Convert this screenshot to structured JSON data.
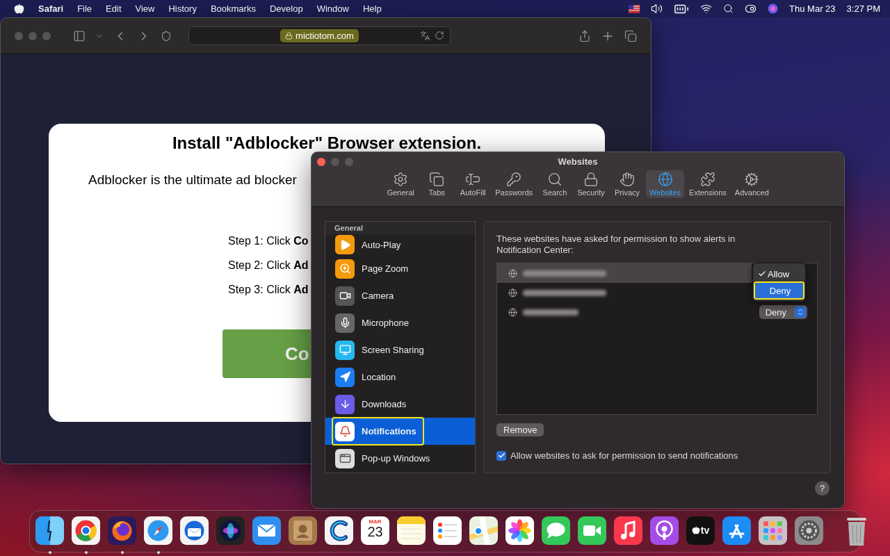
{
  "menu_bar": {
    "app": "Safari",
    "menus": [
      "File",
      "Edit",
      "View",
      "History",
      "Bookmarks",
      "Develop",
      "Window",
      "Help"
    ],
    "date": "Thu Mar 23",
    "time": "3:27 PM"
  },
  "browser": {
    "address": "mictiotom.com",
    "page": {
      "title": "Install \"Adblocker\" Browser extension.",
      "intro": "Adblocker is the ultimate ad blocker",
      "steps": [
        "Step 1: Click **Co**",
        "Step 2: Click **Ad**",
        "Step 3: Click **Ad**"
      ],
      "button": "Co"
    }
  },
  "preferences": {
    "title": "Websites",
    "tabs": [
      {
        "label": "General",
        "kind": "general",
        "selected": false
      },
      {
        "label": "Tabs",
        "kind": "tabs",
        "selected": false
      },
      {
        "label": "AutoFill",
        "kind": "autofill",
        "selected": false
      },
      {
        "label": "Passwords",
        "kind": "passwords",
        "selected": false
      },
      {
        "label": "Search",
        "kind": "search",
        "selected": false
      },
      {
        "label": "Security",
        "kind": "security",
        "selected": false
      },
      {
        "label": "Privacy",
        "kind": "privacy",
        "selected": false
      },
      {
        "label": "Websites",
        "kind": "websites",
        "selected": true
      },
      {
        "label": "Extensions",
        "kind": "extensions",
        "selected": false
      },
      {
        "label": "Advanced",
        "kind": "advanced",
        "selected": false
      }
    ],
    "sidebar": {
      "header": "General",
      "items": [
        {
          "label": "Auto-Play",
          "kind": "autoplay",
          "selected": false,
          "highlighted": false
        },
        {
          "label": "Page Zoom",
          "kind": "zoom",
          "selected": false,
          "highlighted": false
        },
        {
          "label": "Camera",
          "kind": "camera",
          "selected": false,
          "highlighted": false
        },
        {
          "label": "Microphone",
          "kind": "microphone",
          "selected": false,
          "highlighted": false
        },
        {
          "label": "Screen Sharing",
          "kind": "screen",
          "selected": false,
          "highlighted": false
        },
        {
          "label": "Location",
          "kind": "location",
          "selected": false,
          "highlighted": false
        },
        {
          "label": "Downloads",
          "kind": "downloads",
          "selected": false,
          "highlighted": false
        },
        {
          "label": "Notifications",
          "kind": "notifications",
          "selected": true,
          "highlighted": true
        },
        {
          "label": "Pop-up Windows",
          "kind": "popups",
          "selected": false,
          "highlighted": false
        }
      ]
    },
    "description": "These websites have asked for permission to show alerts in Notification Center:",
    "websites": [
      {
        "selected": true
      },
      {
        "selected": false
      },
      {
        "selected": false,
        "setting": "Deny"
      }
    ],
    "menu": {
      "options": [
        {
          "label": "Allow",
          "checked": true,
          "selected": false,
          "highlighted": false
        },
        {
          "label": "Deny",
          "checked": false,
          "selected": true,
          "highlighted": true
        }
      ]
    },
    "remove_button": "Remove",
    "allow_checkbox": {
      "label": "Allow websites to ask for permission to send notifications",
      "checked": true
    },
    "help": "?"
  },
  "dock": [
    {
      "kind": "finder",
      "running": true
    },
    {
      "kind": "chrome",
      "running": true
    },
    {
      "kind": "firefox",
      "running": true
    },
    {
      "kind": "safari",
      "running": true
    },
    {
      "kind": "thunderbird",
      "running": false
    },
    {
      "kind": "siri",
      "running": false
    },
    {
      "kind": "mail",
      "running": false
    },
    {
      "kind": "contacts",
      "running": false
    },
    {
      "kind": "cleaner",
      "running": false
    },
    {
      "kind": "calendar",
      "running": false,
      "month": "MAR",
      "day": "23"
    },
    {
      "kind": "notes",
      "running": false
    },
    {
      "kind": "reminders",
      "running": false
    },
    {
      "kind": "maps",
      "running": false
    },
    {
      "kind": "photos",
      "running": false
    },
    {
      "kind": "messages",
      "running": false
    },
    {
      "kind": "facetime",
      "running": false
    },
    {
      "kind": "music",
      "running": false
    },
    {
      "kind": "podcasts",
      "running": false
    },
    {
      "kind": "tv",
      "running": false,
      "label": "tv"
    },
    {
      "kind": "appstore",
      "running": false
    },
    {
      "kind": "launchpad",
      "running": false
    },
    {
      "kind": "settings",
      "running": false
    },
    {
      "kind": "trash",
      "running": false
    }
  ]
}
